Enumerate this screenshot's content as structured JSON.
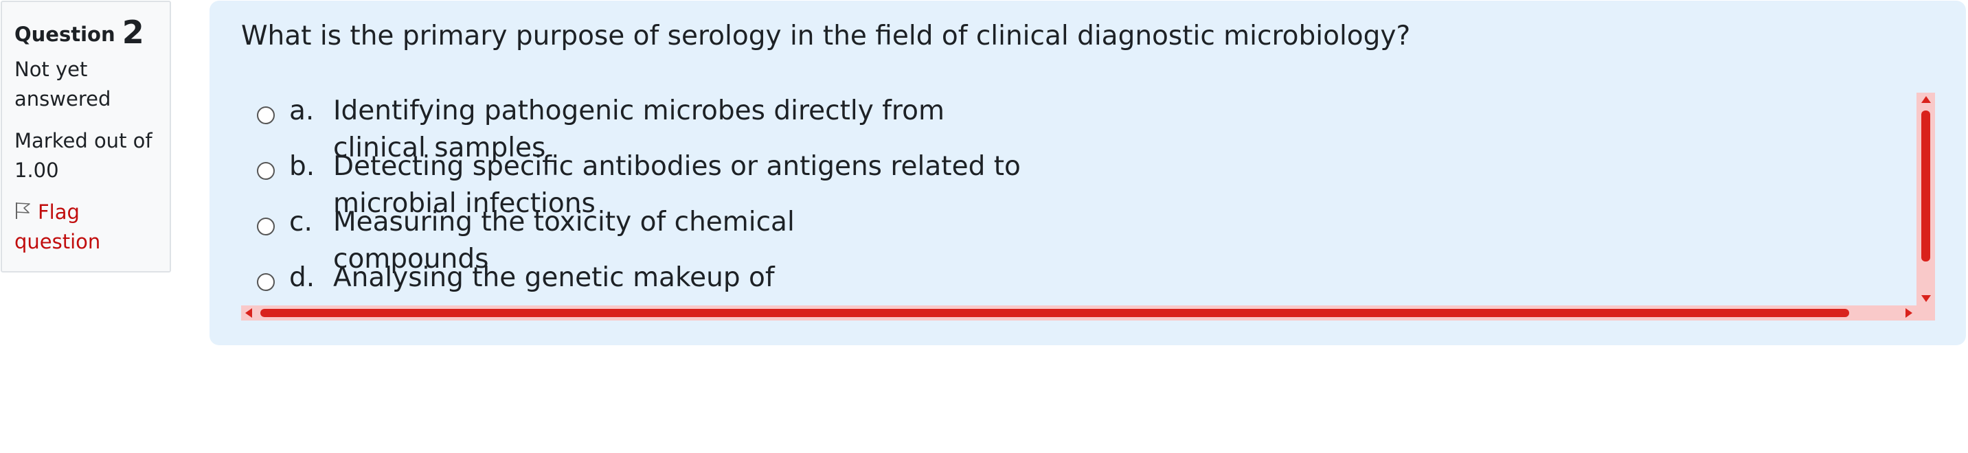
{
  "info": {
    "question_label": "Question",
    "question_number": "2",
    "state": "Not yet answered",
    "grade": "Marked out of 1.00",
    "flag_label": "Flag question",
    "flag_icon": "flag-outline-icon"
  },
  "question": {
    "text": "What is the primary purpose of serology in the field of clinical diagnostic microbiology?",
    "answers": [
      {
        "letter": "a.",
        "text": "Identifying pathogenic microbes directly from clinical samples"
      },
      {
        "letter": "b.",
        "text": "Detecting specific antibodies or antigens related to microbial infections"
      },
      {
        "letter": "c.",
        "text": "Measuring the toxicity of chemical compounds"
      },
      {
        "letter": "d.",
        "text": "Analysing the genetic makeup of"
      }
    ]
  },
  "colors": {
    "panel_background": "#e4f1fc",
    "info_background": "#f8f9fa",
    "flag_link": "#c10d0d",
    "scrollbar_track": "#f9c9c9",
    "scrollbar_thumb": "#d9221c"
  }
}
